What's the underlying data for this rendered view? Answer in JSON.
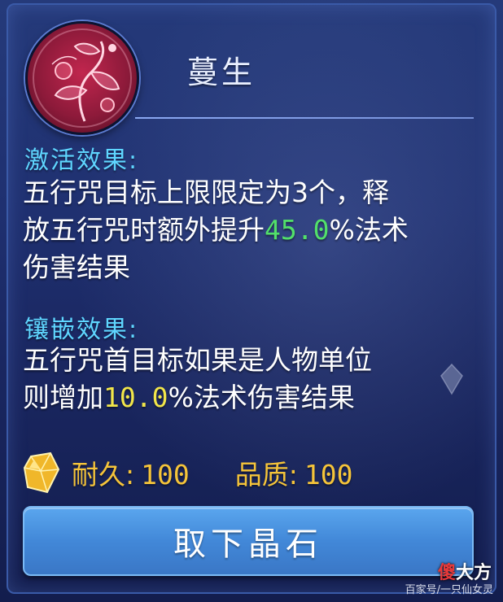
{
  "item": {
    "name": "蔓生",
    "icon": "vine-rune-icon"
  },
  "activation": {
    "title": "激活效果:",
    "line1": "五行咒目标上限限定为3个，释",
    "line2_pre": "放五行咒时额外提升",
    "line2_value": "45.0",
    "line2_post": "%法术",
    "line3": "伤害结果"
  },
  "inlay": {
    "title": "镶嵌效果:",
    "line1": "五行咒首目标如果是人物单位",
    "line2_pre": "则增加",
    "line2_value": "10.0",
    "line2_post": "%法术伤害结果"
  },
  "stats": {
    "durability_label": "耐久:",
    "durability_value": "100",
    "quality_label": "品质:",
    "quality_value": "100"
  },
  "actions": {
    "remove_label": "取下晶石"
  },
  "watermark": {
    "logo_red": "傻",
    "logo_rest": "大方",
    "source": "百家号/一只仙女灵"
  },
  "colors": {
    "section_title": "#5fd6ff",
    "highlight_green": "#52e06a",
    "highlight_yellow": "#f2e64a",
    "stat_gold": "#f5c43a",
    "button_blue": "#4288d8"
  }
}
